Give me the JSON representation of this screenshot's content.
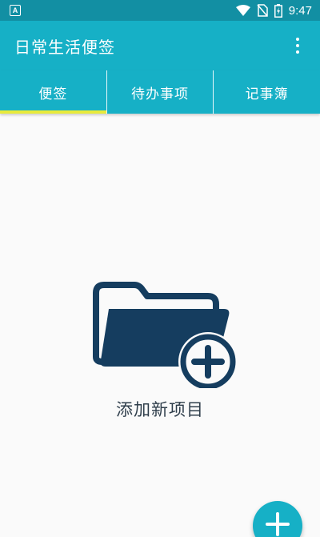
{
  "status_bar": {
    "notification_icon": "A",
    "time": "9:47",
    "icons": [
      "wifi-icon",
      "no-sim-icon",
      "battery-charging-icon"
    ]
  },
  "app_bar": {
    "title": "日常生活便签",
    "overflow_icon": "more-vert-icon"
  },
  "tabs": [
    {
      "label": "便签",
      "active": true
    },
    {
      "label": "待办事项",
      "active": false
    },
    {
      "label": "记事簿",
      "active": false
    }
  ],
  "empty_state": {
    "icon": "folder-add-icon",
    "label": "添加新项目"
  },
  "fab": {
    "icon": "plus-icon"
  },
  "colors": {
    "status_bar": "#128fa3",
    "primary": "#16b0c6",
    "tab_indicator": "#e8ea3c",
    "folder": "#153d5f",
    "background": "#fafafa"
  }
}
